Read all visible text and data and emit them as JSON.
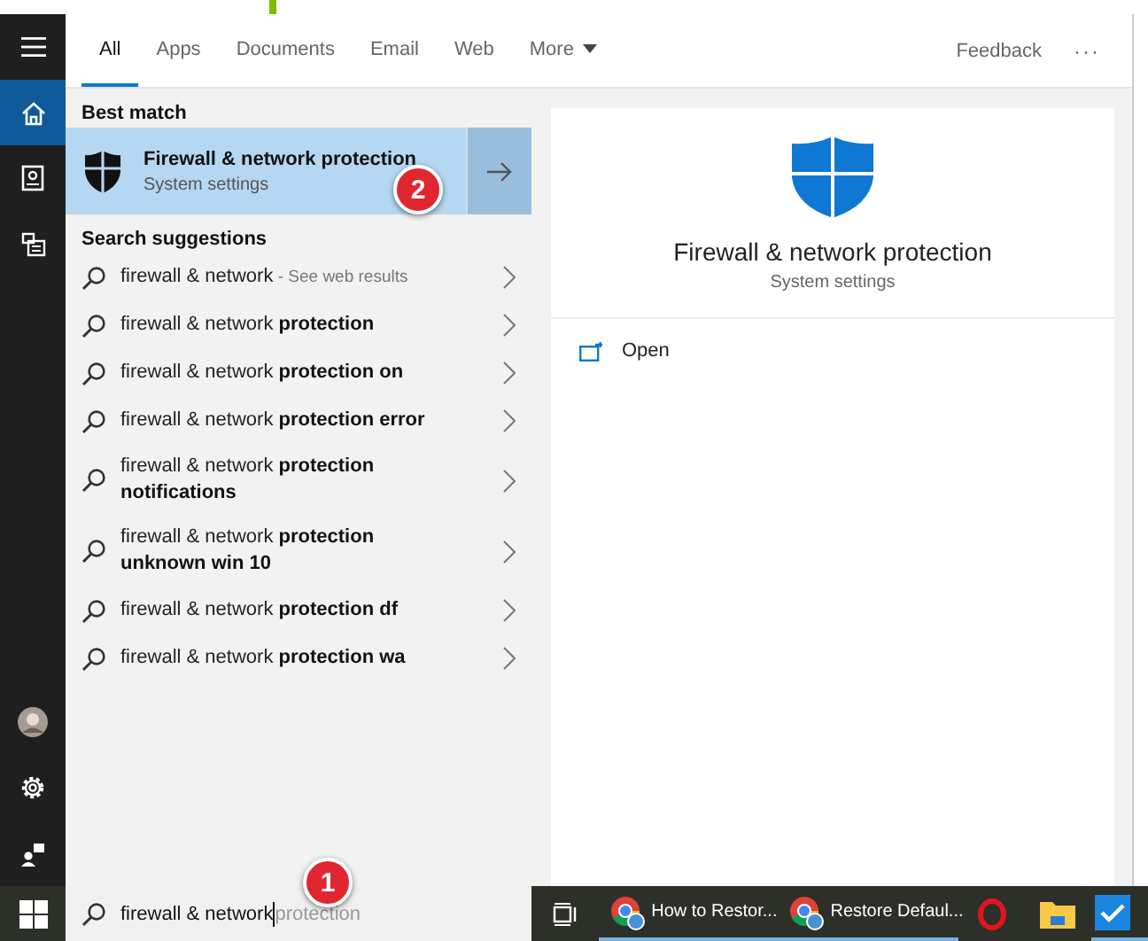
{
  "sidebar": {
    "items": [
      {
        "kind": "menu",
        "selected": false
      },
      {
        "kind": "home",
        "selected": true
      },
      {
        "kind": "notebook",
        "selected": false
      },
      {
        "kind": "documents",
        "selected": false
      }
    ],
    "bottom_items": [
      {
        "kind": "avatar"
      },
      {
        "kind": "settings"
      },
      {
        "kind": "person"
      }
    ]
  },
  "tabs": [
    {
      "label": "All",
      "selected": true
    },
    {
      "label": "Apps",
      "selected": false
    },
    {
      "label": "Documents",
      "selected": false
    },
    {
      "label": "Email",
      "selected": false
    },
    {
      "label": "Web",
      "selected": false
    },
    {
      "label": "More",
      "selected": false,
      "dropdown": true
    }
  ],
  "feedback": "Feedback",
  "more_options": "···",
  "best_match": {
    "heading": "Best match",
    "title": "Firewall & network protection",
    "subtitle": "System settings",
    "selected": true,
    "marker": "2"
  },
  "suggestions_heading": "Search suggestions",
  "suggestions": [
    {
      "text": "firewall & network",
      "hint": "- See web results"
    },
    {
      "text": "firewall & network **protection**"
    },
    {
      "text": "firewall & network **protection on**"
    },
    {
      "text": "firewall & network **protection error**"
    },
    {
      "text": "firewall & network **protection notifications**"
    },
    {
      "text": "firewall & network **protection unknown win 10**"
    },
    {
      "text": "firewall & network **protection df**"
    },
    {
      "text": "firewall & network **protection wa**"
    }
  ],
  "preview": {
    "title": "Firewall & network protection",
    "subtitle": "System settings",
    "actions": [
      {
        "label": "Open"
      }
    ]
  },
  "search": {
    "value": "firewall & network",
    "suggestion": "protection",
    "marker": "1"
  },
  "taskbar": {
    "items": [
      {
        "kind": "task-view"
      },
      {
        "kind": "chrome",
        "label": "How to Restor..."
      },
      {
        "kind": "chrome",
        "label": "Restore Defaul..."
      },
      {
        "kind": "opera"
      },
      {
        "kind": "folder"
      },
      {
        "kind": "check"
      }
    ]
  }
}
